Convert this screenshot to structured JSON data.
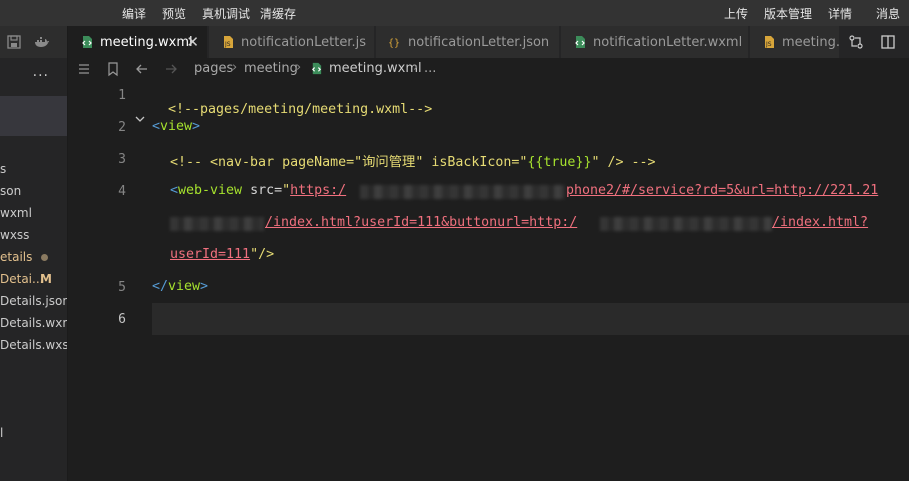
{
  "menubar": {
    "left_items": [
      "编译",
      "预览",
      "真机调试",
      "清缓存"
    ],
    "right_items": [
      "上传",
      "版本管理",
      "详情",
      "消息"
    ]
  },
  "sidebar": {
    "more_label": "...",
    "files": [
      {
        "label": "s",
        "status": ""
      },
      {
        "label": "son",
        "status": ""
      },
      {
        "label": "wxml",
        "status": ""
      },
      {
        "label": "wxss",
        "status": ""
      },
      {
        "label": "etails",
        "status": "dot"
      },
      {
        "label": "Detai...",
        "status": "M"
      },
      {
        "label": "Details.json",
        "status": ""
      },
      {
        "label": "Details.wxml",
        "status": ""
      },
      {
        "label": "Details.wxss",
        "status": ""
      },
      {
        "label": "l",
        "status": ""
      }
    ]
  },
  "tabs": [
    {
      "label": "meeting.wxml",
      "icon": "wxml-icon",
      "active": true,
      "close": "✕"
    },
    {
      "label": "notificationLetter.js",
      "icon": "js-icon",
      "active": false
    },
    {
      "label": "notificationLetter.json",
      "icon": "json-icon",
      "active": false
    },
    {
      "label": "notificationLetter.wxml",
      "icon": "wxml-icon",
      "active": false
    },
    {
      "label": "meeting.",
      "icon": "js-icon",
      "active": false
    }
  ],
  "breadcrumb": {
    "items": [
      "pages",
      "meeting",
      "meeting.wxml",
      "..."
    ],
    "separator": "›"
  },
  "editor": {
    "line_numbers": [
      "1",
      "2",
      "3",
      "4",
      "5",
      "6"
    ],
    "lines": {
      "l1": "<!--pages/meeting/meeting.wxml-->",
      "l2_open": "<",
      "l2_tag": "view",
      "l2_close": ">",
      "l3": "<!-- <nav-bar pageName=\"询问管理\" isBackIcon=\"",
      "l3_expr": "{{true}}",
      "l3_end": "\" /> -->",
      "l4_open": "<",
      "l4_tag": "web-view",
      "l4_attr": " src=",
      "l4_quote": "\"",
      "l4_url1": "https:/",
      "l4_url2": "phone2/#/service?rd=5&url=http://221.21",
      "l4b_url": "/index.html?userId=111&buttonurl=http:/",
      "l4b_url2": "/index.html?",
      "l4c_url": "userId=111",
      "l4c_end": "\"/>",
      "l5_open": "</",
      "l5_tag": "view",
      "l5_close": ">"
    }
  },
  "colors": {
    "background": "#1e1e1e",
    "sidebar": "#252526",
    "menubar": "#333333",
    "comment": "#e6db74",
    "link": "#f0707e",
    "attribute": "#a6e22e",
    "modified": "#e2c08d"
  }
}
